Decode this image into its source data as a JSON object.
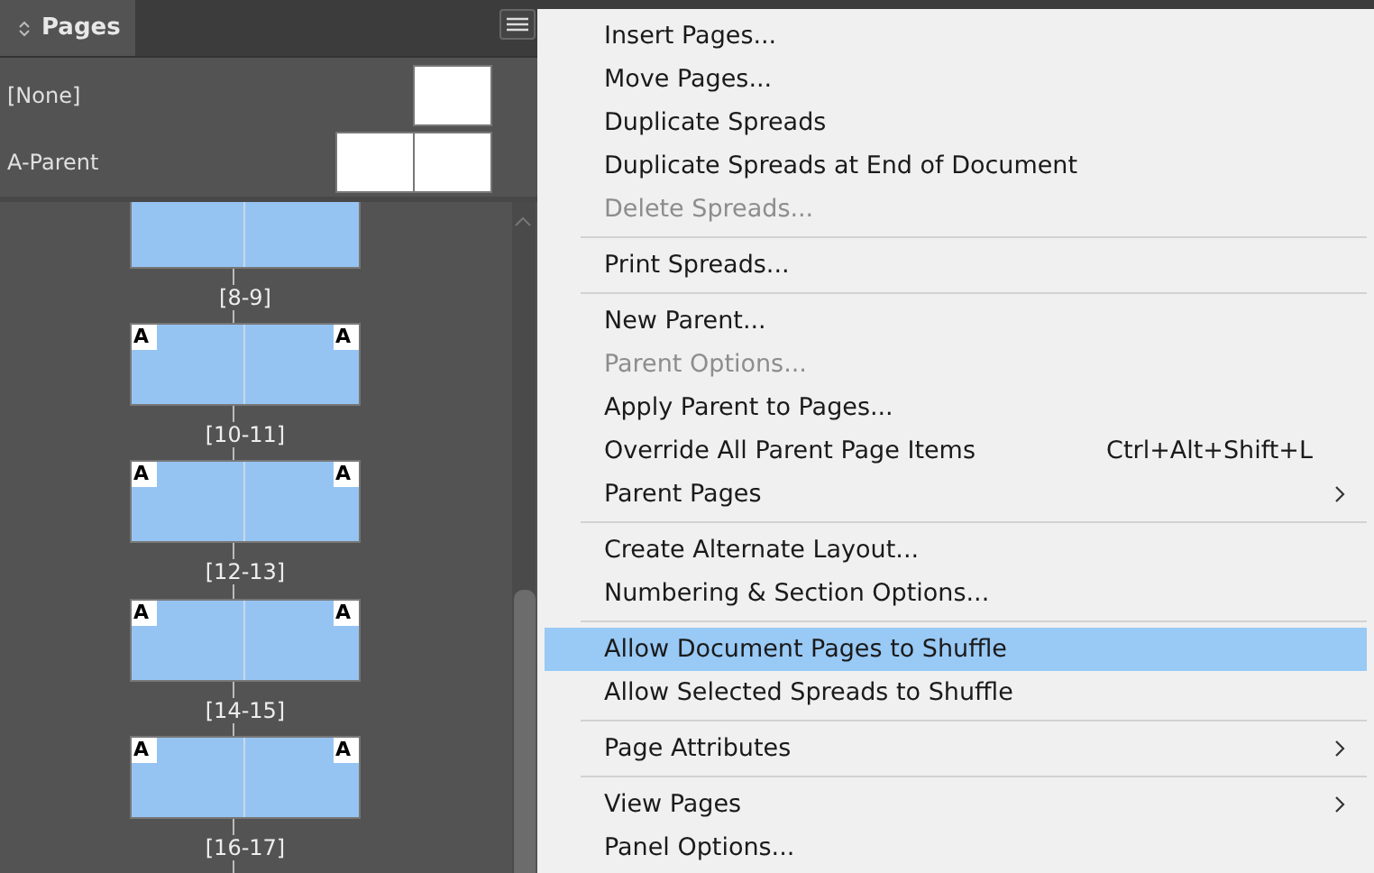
{
  "panel": {
    "title": "Pages",
    "parents": [
      {
        "name": "[None]",
        "kind": "single"
      },
      {
        "name": "A-Parent",
        "kind": "spread"
      }
    ],
    "spreads": [
      {
        "label": "[8-9]"
      },
      {
        "label": "[10-11]",
        "left_marker": "A",
        "right_marker": "A"
      },
      {
        "label": "[12-13]",
        "left_marker": "A",
        "right_marker": "A"
      },
      {
        "label": "[14-15]",
        "left_marker": "A",
        "right_marker": "A"
      },
      {
        "label": "[16-17]",
        "left_marker": "A",
        "right_marker": "A"
      }
    ]
  },
  "menu": {
    "items": [
      {
        "kind": "item",
        "label": "Insert Pages...",
        "disabled": false,
        "selected": false
      },
      {
        "kind": "item",
        "label": "Move Pages...",
        "disabled": false,
        "selected": false
      },
      {
        "kind": "item",
        "label": "Duplicate Spreads",
        "disabled": false,
        "selected": false
      },
      {
        "kind": "item",
        "label": "Duplicate Spreads at End of Document",
        "disabled": false,
        "selected": false
      },
      {
        "kind": "item",
        "label": "Delete Spreads...",
        "disabled": true,
        "selected": false
      },
      {
        "kind": "separator"
      },
      {
        "kind": "item",
        "label": "Print Spreads...",
        "disabled": false,
        "selected": false
      },
      {
        "kind": "separator"
      },
      {
        "kind": "item",
        "label": "New Parent...",
        "disabled": false,
        "selected": false
      },
      {
        "kind": "item",
        "label": "Parent Options...",
        "disabled": true,
        "selected": false
      },
      {
        "kind": "item",
        "label": "Apply Parent to Pages...",
        "disabled": false,
        "selected": false
      },
      {
        "kind": "item",
        "label": "Override All Parent Page Items",
        "shortcut": "Ctrl+Alt+Shift+L",
        "disabled": false,
        "selected": false
      },
      {
        "kind": "item",
        "label": "Parent Pages",
        "submenu": true,
        "disabled": false,
        "selected": false
      },
      {
        "kind": "separator"
      },
      {
        "kind": "item",
        "label": "Create Alternate Layout...",
        "disabled": false,
        "selected": false
      },
      {
        "kind": "item",
        "label": "Numbering & Section Options...",
        "disabled": false,
        "selected": false
      },
      {
        "kind": "separator"
      },
      {
        "kind": "item",
        "label": "Allow Document Pages to Shuffle",
        "disabled": false,
        "selected": true
      },
      {
        "kind": "item",
        "label": "Allow Selected Spreads to Shuffle",
        "disabled": false,
        "selected": false
      },
      {
        "kind": "separator"
      },
      {
        "kind": "item",
        "label": "Page Attributes",
        "submenu": true,
        "disabled": false,
        "selected": false
      },
      {
        "kind": "separator"
      },
      {
        "kind": "item",
        "label": "View Pages",
        "submenu": true,
        "disabled": false,
        "selected": false
      },
      {
        "kind": "item",
        "label": "Panel Options...",
        "disabled": false,
        "selected": false
      }
    ]
  }
}
